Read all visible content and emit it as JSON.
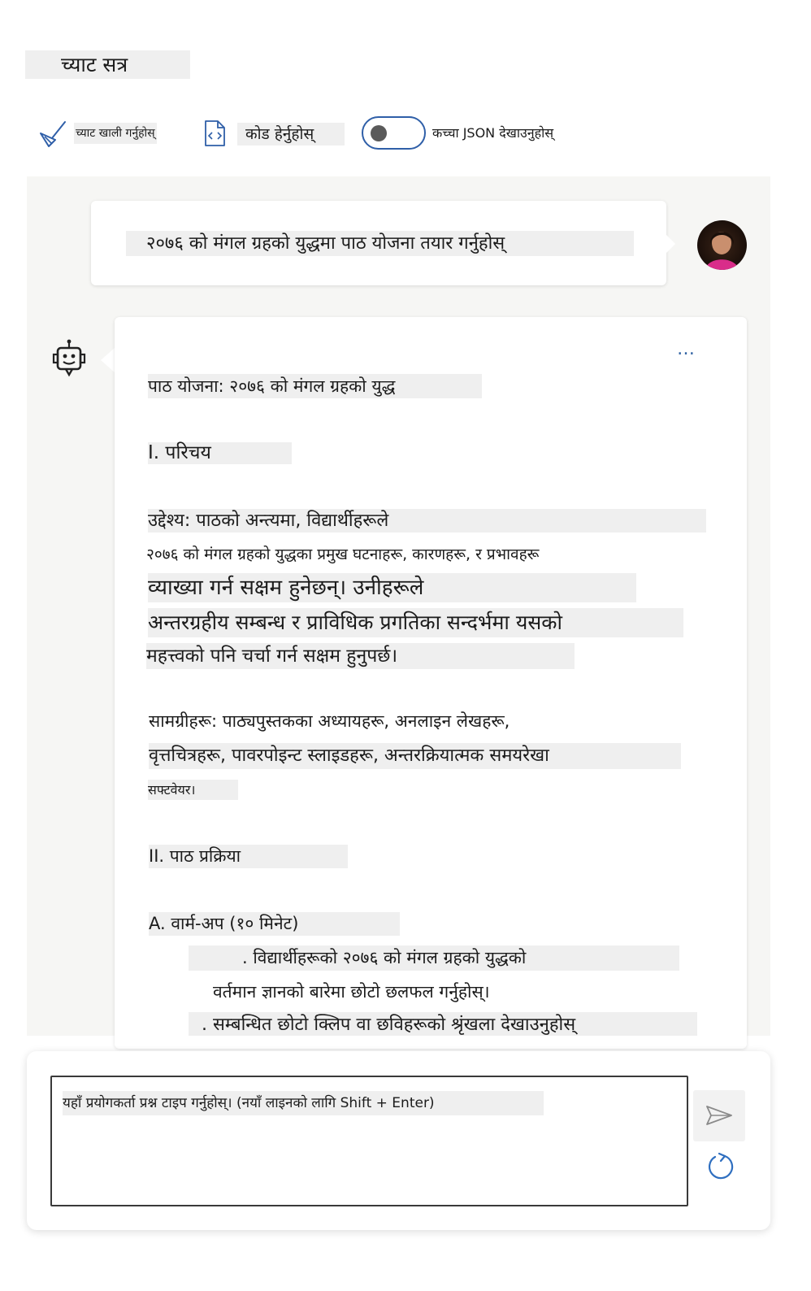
{
  "page": {
    "title": "च्याट सत्र"
  },
  "toolbar": {
    "clear_label": "च्याट खाली गर्नुहोस्",
    "clear_icon": "broom-icon",
    "view_code_label": "कोड हेर्नुहोस्",
    "view_code_icon": "code-file-icon",
    "raw_json_label": "कच्चा JSON देखाउनुहोस्",
    "raw_json_enabled": false
  },
  "conversation": {
    "user_message": "२०७६ को मंगल ग्रहको युद्धमा पाठ योजना तयार गर्नुहोस्",
    "assistant_more": "…",
    "assistant_lines": [
      "पाठ योजना: २०७६ को मंगल ग्रहको युद्ध",
      "I. परिचय",
      "उद्देश्य: पाठको अन्त्यमा, विद्यार्थीहरूले",
      "२०७६ को मंगल ग्रहको युद्धका प्रमुख घटनाहरू, कारणहरू, र प्रभावहरू",
      "व्याख्या गर्न सक्षम हुनेछन्। उनीहरूले",
      "अन्तरग्रहीय सम्बन्ध र प्राविधिक प्रगतिका सन्दर्भमा यसको",
      "महत्त्वको पनि चर्चा गर्न सक्षम हुनुपर्छ।",
      "सामग्रीहरू: पाठ्यपुस्तकका अध्यायहरू, अनलाइन लेखहरू,",
      "वृत्तचित्रहरू, पावरपोइन्ट स्लाइडहरू, अन्तरक्रियात्मक समयरेखा",
      "सफ्टवेयर।",
      "II. पाठ प्रक्रिया",
      "A. वार्म-अप (१० मिनेट)",
      ". विद्यार्थीहरूको २०७६ को मंगल ग्रहको युद्धको",
      "वर्तमान ज्ञानको बारेमा छोटो छलफल गर्नुहोस्।",
      ". सम्बन्धित छोटो क्लिप वा छविहरूको श्रृंखला देखाउनुहोस्"
    ]
  },
  "input": {
    "placeholder": "यहाँ प्रयोगकर्ता प्रश्न टाइप गर्नुहोस्। (नयाँ लाइनको लागि Shift + Enter)",
    "send_icon": "send-icon",
    "reset_icon": "refresh-icon"
  },
  "colors": {
    "accent": "#2f5fa8",
    "panel": "#f6f6f4",
    "highlight": "#efefef"
  }
}
